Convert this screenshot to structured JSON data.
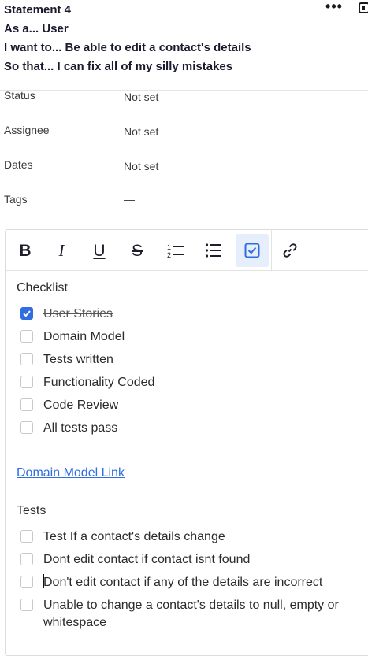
{
  "header": {
    "title": "Statement 4",
    "as_a": "As a... User",
    "want": "I want to... Be able to edit a contact's details",
    "so_that": "So that... I can fix all of my silly mistakes"
  },
  "properties": [
    {
      "label": "Status",
      "value": "Not set"
    },
    {
      "label": "Assignee",
      "value": "Not set"
    },
    {
      "label": "Dates",
      "value": "Not set"
    },
    {
      "label": "Tags",
      "value": "—"
    }
  ],
  "toolbar": {
    "bold": "B",
    "italic": "I",
    "underline": "U",
    "strike": "S",
    "numbered_list": "numbered-list-icon",
    "bullet_list": "bullet-list-icon",
    "checklist": "checklist-icon",
    "link": "link-icon",
    "active_color": "#e7eefb"
  },
  "checklist": {
    "heading": "Checklist",
    "items": [
      {
        "label": "User Stories",
        "checked": true
      },
      {
        "label": "Domain Model",
        "checked": false
      },
      {
        "label": "Tests written",
        "checked": false
      },
      {
        "label": "Functionality Coded",
        "checked": false
      },
      {
        "label": "Code Review",
        "checked": false
      },
      {
        "label": "All tests pass",
        "checked": false
      }
    ]
  },
  "link": {
    "label": "Domain Model Link"
  },
  "tests": {
    "heading": "Tests",
    "items": [
      {
        "label": "Test If a contact's details change",
        "checked": false
      },
      {
        "label": "Dont edit contact if contact isnt found",
        "checked": false
      },
      {
        "label": "Don't edit contact if any of the details are incorrect",
        "checked": false
      },
      {
        "label": "Unable to change a contact's details to null, empty or whitespace",
        "checked": false
      }
    ]
  },
  "colors": {
    "accent": "#2f6de1",
    "text": "#2b2b2b"
  }
}
